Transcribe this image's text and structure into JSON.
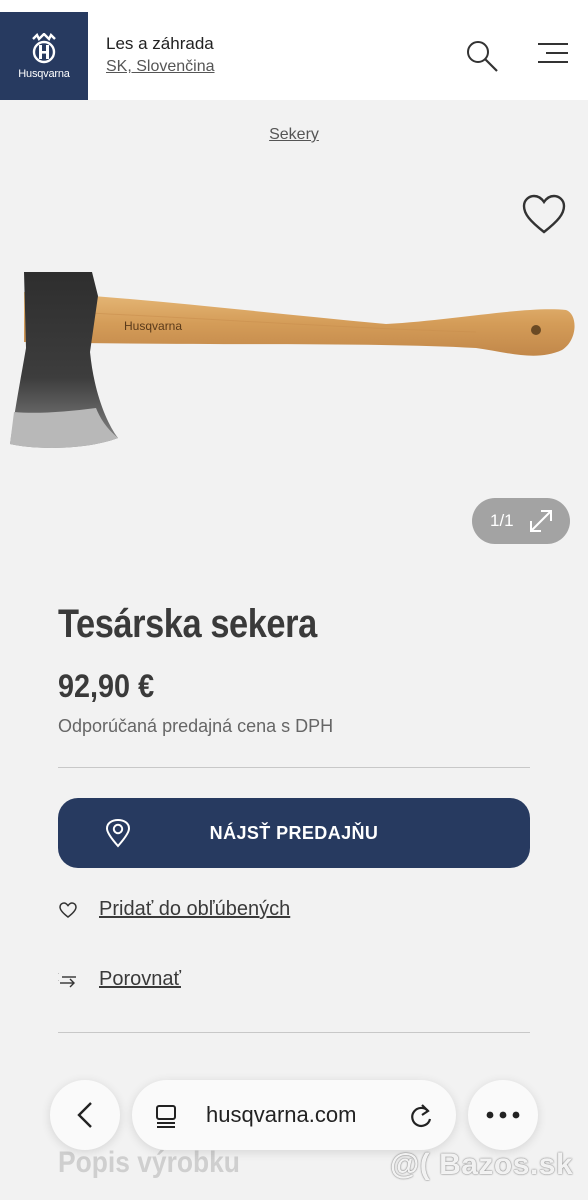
{
  "header": {
    "brand": "Husqvarna",
    "title": "Les a záhrada",
    "language": "SK, Slovenčina",
    "icons": [
      "search-icon",
      "menu-icon"
    ]
  },
  "breadcrumb": "Sekery",
  "gallery": {
    "counter": "1/1",
    "image_logo": "Husqvarna"
  },
  "product": {
    "name": "Tesárska sekera",
    "price": "92,90 €",
    "price_note": "Odporúčaná predajná cena s DPH"
  },
  "actions": {
    "find_store": "NÁJSŤ PREDAJŇU",
    "add_favorite": "Pridať do obľúbených",
    "compare": "Porovnať"
  },
  "section": {
    "description_title": "Popis výrobku"
  },
  "browser": {
    "url": "husqvarna.com"
  },
  "watermark": "@( Bazos.sk",
  "colors": {
    "brand_navy": "#273a60",
    "background": "#f2f2f2"
  }
}
